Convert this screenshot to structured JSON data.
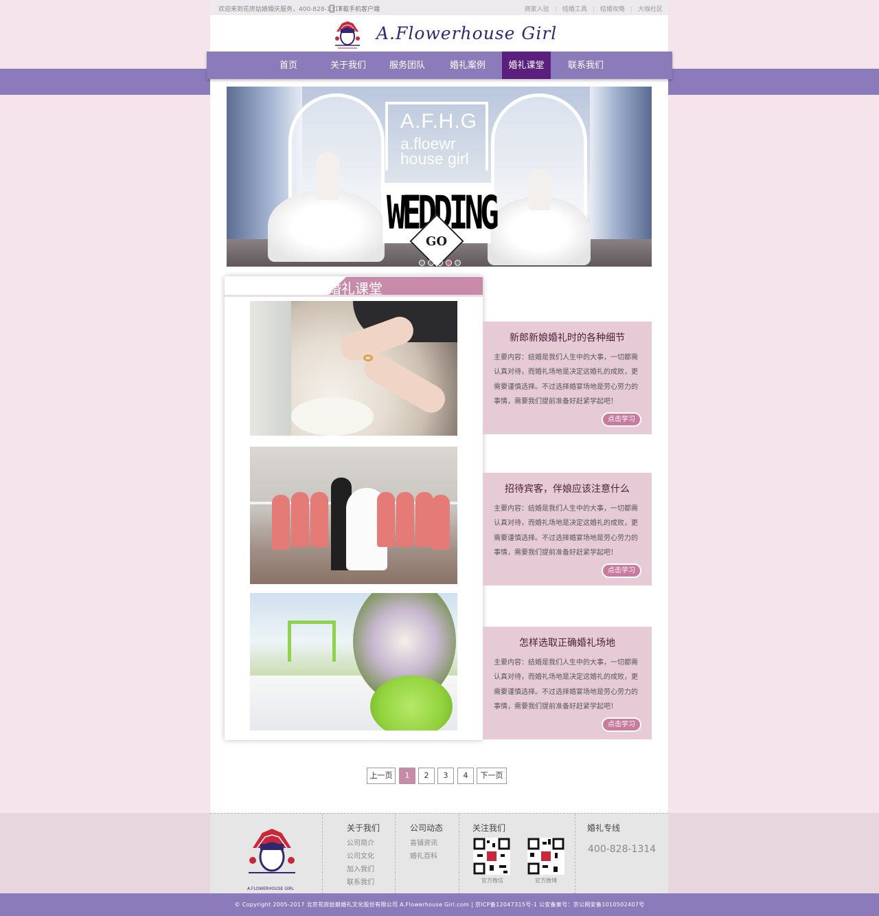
{
  "topbar": {
    "welcome": "欢迎来到花房姑娘婚庆服务，400-828-1314",
    "download": "下载手机客户端",
    "links": [
      "商家入驻",
      "结婚工具",
      "结婚攻略",
      "大咖社区"
    ]
  },
  "brand": {
    "name": "A.Flowerhouse Girl"
  },
  "nav": {
    "items": [
      {
        "label": "首页"
      },
      {
        "label": "关于我们"
      },
      {
        "label": "服务团队"
      },
      {
        "label": "婚礼案例"
      },
      {
        "label": "婚礼课堂",
        "active": true
      },
      {
        "label": "联系我们"
      }
    ]
  },
  "banner": {
    "abbr": "A.F.H.G",
    "line1": "a.floewr",
    "line2": "house girl",
    "wedding": "WEDDING",
    "go": "GO",
    "slide_count": 5,
    "active_slide": 4
  },
  "section": {
    "title": "婚礼课堂"
  },
  "lessons": [
    {
      "title": "新郎新娘婚礼时的各种细节",
      "desc": "主要内容：结婚是我们人生中的大事，一切都需认真对待，而婚礼场地是决定这婚礼的成败，更需要谨慎选择。不过选择婚宴场地是劳心劳力的事情，需要我们提前准备好赶紧学起吧！",
      "button": "点击学习",
      "photo": "wedding-ring-photo"
    },
    {
      "title": "招待宾客，伴娘应该注意什么",
      "desc": "主要内容：结婚是我们人生中的大事，一切都需认真对待，而婚礼场地是决定这婚礼的成败，更需要谨慎选择。不过选择婚宴场地是劳心劳力的事情，需要我们提前准备好赶紧学起吧！",
      "button": "点击学习",
      "photo": "bridesmaids-photo"
    },
    {
      "title": "怎样选取正确婚礼场地",
      "desc": "主要内容：结婚是我们人生中的大事，一切都需认真对待，而婚礼场地是决定这婚礼的成败，更需要谨慎选择。不过选择婚宴场地是劳心劳力的事情，需要我们提前准备好赶紧学起吧！",
      "button": "点击学习",
      "photo": "outdoor-venue-photo"
    }
  ],
  "pager": {
    "prev": "上一页",
    "pages": [
      "1",
      "2",
      "3",
      "4"
    ],
    "current": "1",
    "next": "下一页"
  },
  "footer": {
    "logo_text": "A.FLOWERHOUSE GIRL",
    "about": {
      "title": "关于我们",
      "links": [
        "公司简介",
        "公司文化",
        "加入我们",
        "联系我们"
      ]
    },
    "news": {
      "title": "公司动态",
      "links": [
        "喜铺资讯",
        "婚礼百科"
      ]
    },
    "follow": {
      "title": "关注我们",
      "qr": [
        "官方微信",
        "官方微博"
      ]
    },
    "hotline": {
      "title": "婚礼专线",
      "number": "400-828-1314"
    }
  },
  "copyright": "© Copyright 2005-2017 北京花房姑娘婚礼文化股份有限公司 A.Flowerhouse Girl.com | 京ICP备12047315号-1 公安备案号：京公网安备1010502407号",
  "colors": {
    "background": "#f6e4ec",
    "nav": "#8b7bba",
    "nav_active": "#5b1f7e",
    "section_pink": "#c78aa8",
    "lesson_bg": "#e6cbd6"
  }
}
